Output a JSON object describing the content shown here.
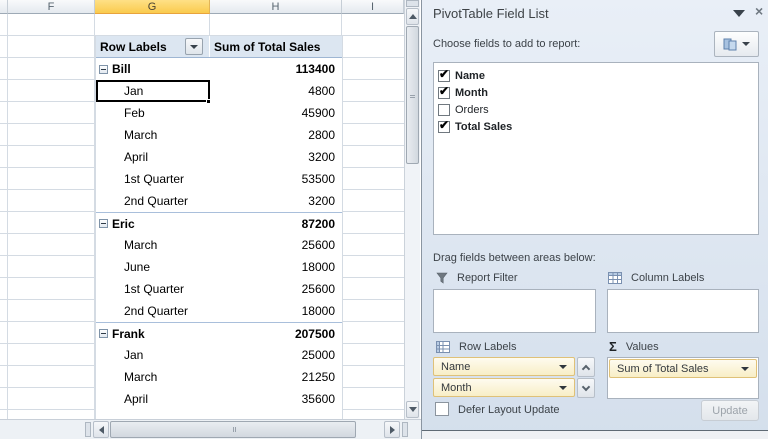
{
  "sheet": {
    "columns": [
      "F",
      "G",
      "H",
      "I"
    ],
    "selected_column": "G",
    "pivot": {
      "row_labels_header": "Row Labels",
      "values_header": "Sum of Total Sales",
      "rows": [
        {
          "label": "Bill",
          "value": "113400",
          "type": "group"
        },
        {
          "label": "Jan",
          "value": "4800",
          "type": "item",
          "selected": true
        },
        {
          "label": "Feb",
          "value": "45900",
          "type": "item"
        },
        {
          "label": "March",
          "value": "2800",
          "type": "item"
        },
        {
          "label": "April",
          "value": "3200",
          "type": "item"
        },
        {
          "label": "1st Quarter",
          "value": "53500",
          "type": "item"
        },
        {
          "label": "2nd Quarter",
          "value": "3200",
          "type": "item"
        },
        {
          "label": "Eric",
          "value": "87200",
          "type": "group"
        },
        {
          "label": "March",
          "value": "25600",
          "type": "item"
        },
        {
          "label": "June",
          "value": "18000",
          "type": "item"
        },
        {
          "label": "1st Quarter",
          "value": "25600",
          "type": "item"
        },
        {
          "label": "2nd Quarter",
          "value": "18000",
          "type": "item"
        },
        {
          "label": "Frank",
          "value": "207500",
          "type": "group"
        },
        {
          "label": "Jan",
          "value": "25000",
          "type": "item"
        },
        {
          "label": "March",
          "value": "21250",
          "type": "item"
        },
        {
          "label": "April",
          "value": "35600",
          "type": "item"
        }
      ]
    }
  },
  "panel": {
    "title": "PivotTable Field List",
    "choose_fields_label": "Choose fields to add to report:",
    "fields": [
      {
        "label": "Name",
        "checked": true
      },
      {
        "label": "Month",
        "checked": true
      },
      {
        "label": "Orders",
        "checked": false
      },
      {
        "label": "Total Sales",
        "checked": true
      }
    ],
    "drag_fields_label": "Drag fields between areas below:",
    "areas": {
      "report_filter": {
        "label": "Report Filter",
        "items": []
      },
      "column_labels": {
        "label": "Column Labels",
        "items": []
      },
      "row_labels": {
        "label": "Row Labels",
        "items": [
          "Name",
          "Month"
        ]
      },
      "values": {
        "label": "Values",
        "items": [
          "Sum of Total Sales"
        ]
      }
    },
    "defer_layout_label": "Defer Layout Update",
    "update_button_label": "Update"
  },
  "icons": {
    "checkmark": "✔",
    "close": "×",
    "sigma": "Σ"
  },
  "colors": {
    "selected_column_header": "#FACB4E",
    "pivot_header_fill": "#DCE6F1",
    "pivot_border": "#9EB6D3",
    "panel_bg": "#DCE6F1",
    "pill_fill": "#F8EEC6",
    "pill_border": "#DFC178",
    "gridline": "#D4DBE3",
    "active_cell_border": "#000000"
  }
}
